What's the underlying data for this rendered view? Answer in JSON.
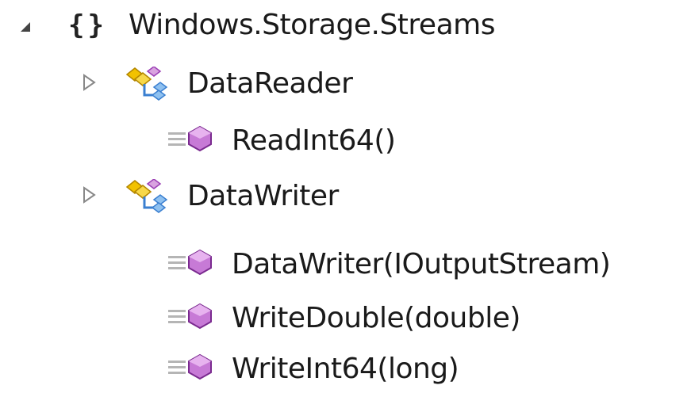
{
  "tree": {
    "namespace": {
      "label": "Windows.Storage.Streams",
      "icon": "namespace-icon",
      "expanded": true
    },
    "items": [
      {
        "kind": "class",
        "label": "DataReader",
        "icon": "class-icon",
        "expanded": false
      },
      {
        "kind": "method",
        "label": "ReadInt64()",
        "icon": "method-icon"
      },
      {
        "kind": "class",
        "label": "DataWriter",
        "icon": "class-icon",
        "expanded": false
      },
      {
        "kind": "method",
        "label": "DataWriter(IOutputStream)",
        "icon": "method-icon"
      },
      {
        "kind": "method",
        "label": "WriteDouble(double)",
        "icon": "method-icon"
      },
      {
        "kind": "method",
        "label": "WriteInt64(long)",
        "icon": "method-icon"
      }
    ]
  },
  "colors": {
    "method_icon": "#9b3fb5",
    "class_icon_gold": "#e8b800",
    "class_icon_blue": "#3a7fd0",
    "expander": "#888888"
  }
}
